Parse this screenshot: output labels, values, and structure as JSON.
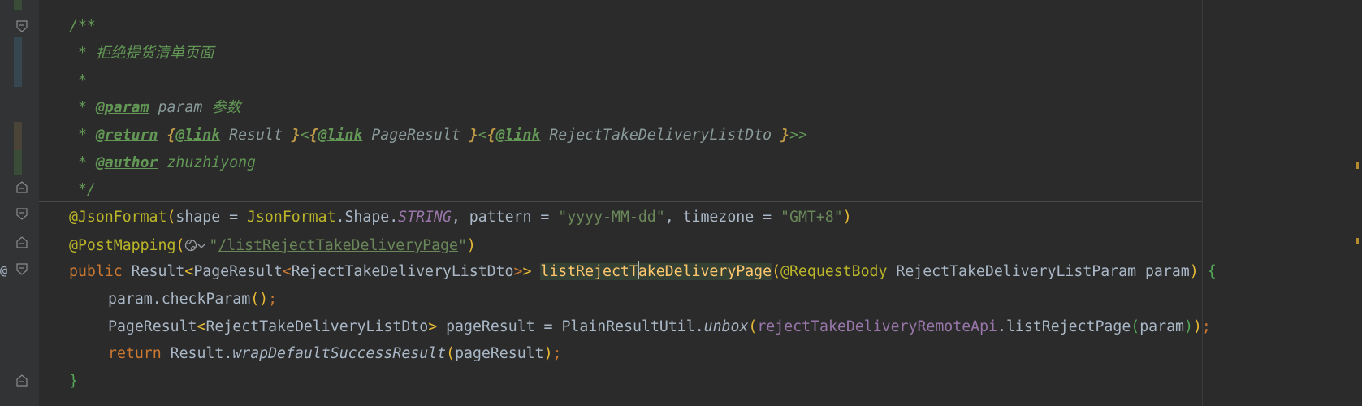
{
  "javadoc": {
    "open": "/**",
    "summary": "拒绝提货清单页面",
    "blank": "*",
    "star": "*",
    "param_tag": "@param",
    "param_name": "param",
    "param_desc": "参数",
    "return_tag": "@return",
    "link_tag": "@link",
    "type_result": "Result",
    "type_page_result": "PageResult",
    "type_dto": "RejectTakeDeliveryListDto",
    "gt_gt": ">>",
    "author_tag": "@author",
    "author_name": "zhuzhiyong",
    "close": "*/"
  },
  "annotations": {
    "json_format": "@JsonFormat",
    "shape_key": "shape = ",
    "json_format_cls": "JsonFormat",
    "shape_path": ".Shape.",
    "string_const": "STRING",
    "pattern_key": ", pattern = ",
    "pattern_val": "\"yyyy-MM-dd\"",
    "timezone_key": ", timezone = ",
    "timezone_val": "\"GMT+8\"",
    "post_mapping": "@PostMapping",
    "path_quote": "\"",
    "path": "/listRejectTakeDeliveryPage",
    "path_end": "\""
  },
  "signature": {
    "public": "public",
    "ret_result": " Result",
    "ret_page": "PageResult",
    "ret_dto": "RejectTakeDeliveryListDto",
    "method_a": "listRejectT",
    "method_b": "akeDeliveryPage",
    "request_body": "@RequestBody",
    "param_decl": " RejectTakeDeliveryListParam param",
    "open_brace": "{"
  },
  "body": {
    "check_param": "param.checkParam",
    "page_result_type": "PageResult",
    "page_result_dto": "RejectTakeDeliveryListDto",
    "page_result_var": " pageResult = PlainResultUtil.",
    "unbox": "unbox",
    "remote_api": "rejectTakeDeliveryRemoteApi",
    "list_reject_page": ".listRejectPage",
    "arg_param": "param",
    "return": "return",
    "result_cls": " Result.",
    "wrap": "wrapDefaultSuccessResult",
    "wrap_arg": "pageResult",
    "close_brace": "}"
  },
  "gutter": {
    "at_marker": "@"
  },
  "colors": {
    "background": "#2b2b2b",
    "gutter": "#313335",
    "comment": "#629755",
    "keyword": "#cc7832",
    "annotation": "#bbb529",
    "string": "#6a8759",
    "method_decl": "#ffc66d",
    "field": "#9876aa"
  }
}
